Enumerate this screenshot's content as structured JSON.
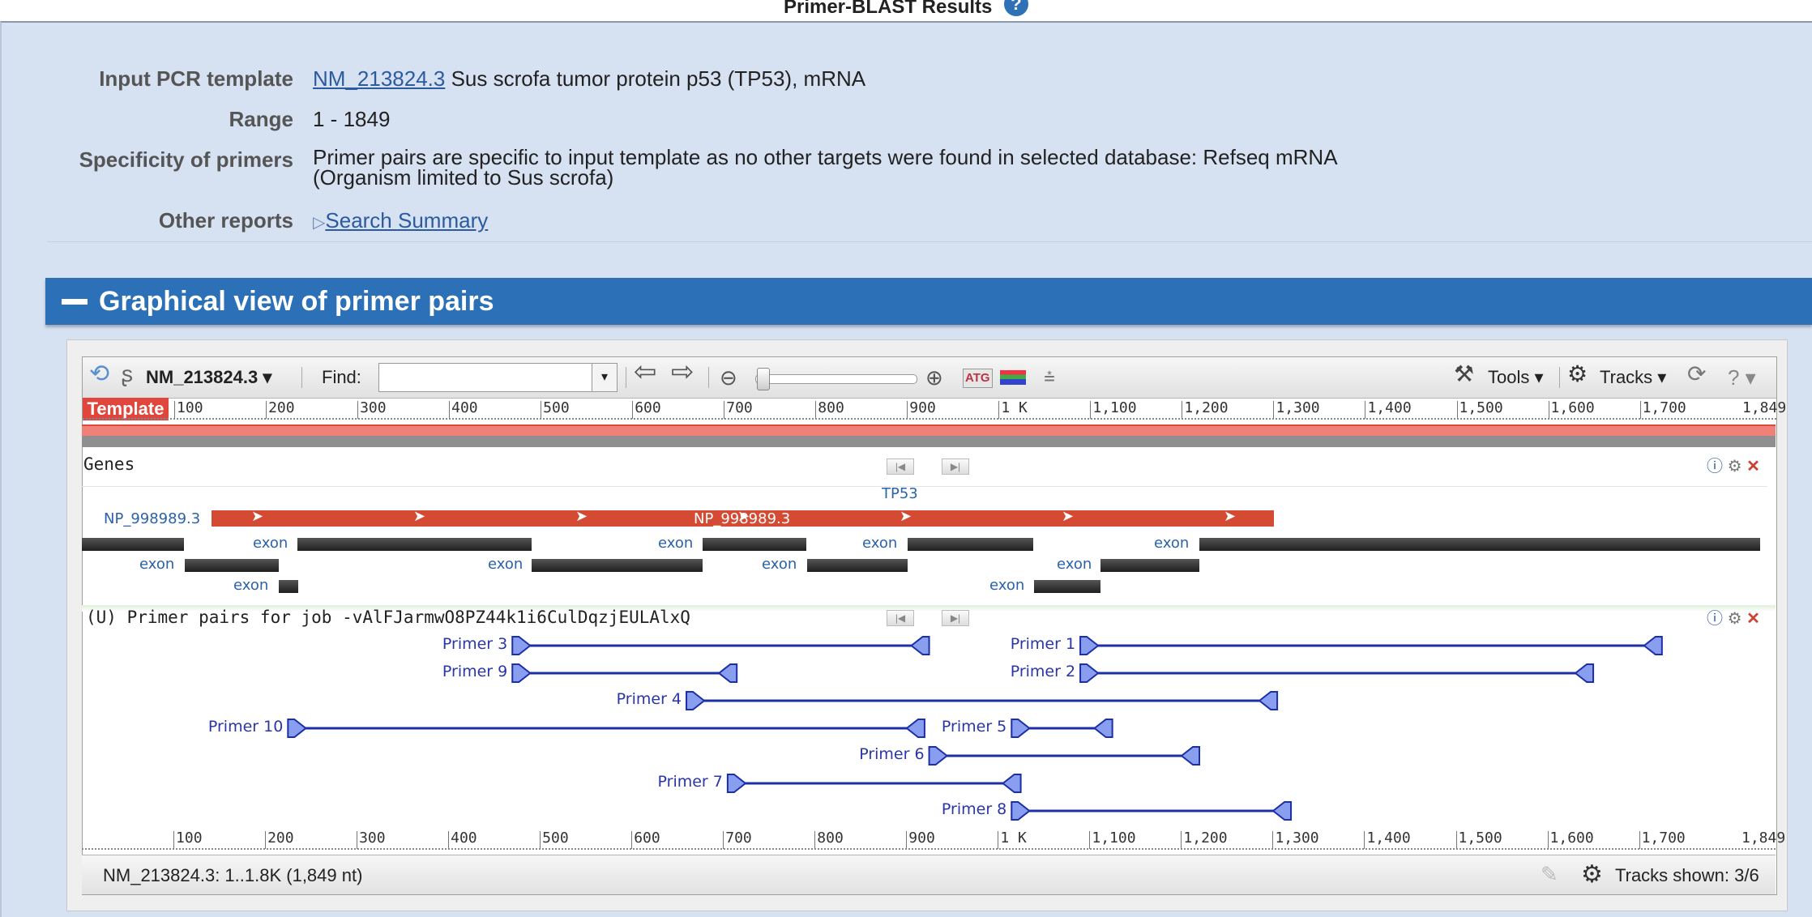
{
  "page_title": "Primer-BLAST Results",
  "info": {
    "template_label": "Input PCR template",
    "template_accession": "NM_213824.3",
    "template_desc": " Sus scrofa tumor protein p53 (TP53), mRNA",
    "range_label": "Range",
    "range_value": "1 - 1849",
    "specificity_label": "Specificity of primers",
    "specificity_line1": "Primer pairs are specific to input template as no other targets were found in selected database: Refseq mRNA",
    "specificity_line2": "(Organism limited to Sus scrofa)",
    "reports_label": "Other reports",
    "reports_link": "Search Summary"
  },
  "section": {
    "title": "Graphical view of primer pairs"
  },
  "toolbar": {
    "sequence": "NM_213824.3 ▾",
    "find_label": "Find:",
    "tools_label": "Tools ▾",
    "tracks_label": "Tracks ▾"
  },
  "ruler": {
    "ticks": [
      "100",
      "200",
      "300",
      "400",
      "500",
      "600",
      "700",
      "800",
      "900",
      "1 K",
      "1,100",
      "1,200",
      "1,300",
      "1,400",
      "1,500",
      "1,600",
      "1,700",
      "1,849"
    ],
    "template_label": "Template"
  },
  "genes_track": {
    "title": "Genes",
    "gene_name": "TP53",
    "protein_left": "NP_998989.3",
    "protein_center": "NP_998989.3",
    "exon_label": "exon"
  },
  "primer_track": {
    "title": "(U) Primer pairs for job -vAlFJarmwO8PZ44k1i6CulDqzjEULAlxQ",
    "pairs": [
      {
        "name": "Primer 1",
        "start": 1090,
        "end": 1725
      },
      {
        "name": "Primer 2",
        "start": 1090,
        "end": 1650
      },
      {
        "name": "Primer 3",
        "start": 470,
        "end": 925
      },
      {
        "name": "Primer 4",
        "start": 660,
        "end": 1305
      },
      {
        "name": "Primer 5",
        "start": 1015,
        "end": 1125
      },
      {
        "name": "Primer 6",
        "start": 925,
        "end": 1220
      },
      {
        "name": "Primer 7",
        "start": 705,
        "end": 1025
      },
      {
        "name": "Primer 8",
        "start": 1015,
        "end": 1320
      },
      {
        "name": "Primer 9",
        "start": 470,
        "end": 715
      },
      {
        "name": "Primer 10",
        "start": 225,
        "end": 920
      }
    ]
  },
  "status": {
    "range_text": "NM_213824.3: 1..1.8K (1,849 nt)",
    "tracks_shown": "Tracks shown: 3/6"
  },
  "colors": {
    "accent": "#2c70b7",
    "template": "#e0463b",
    "primer": "#1b2fa8",
    "gene": "#2b2b2b"
  }
}
